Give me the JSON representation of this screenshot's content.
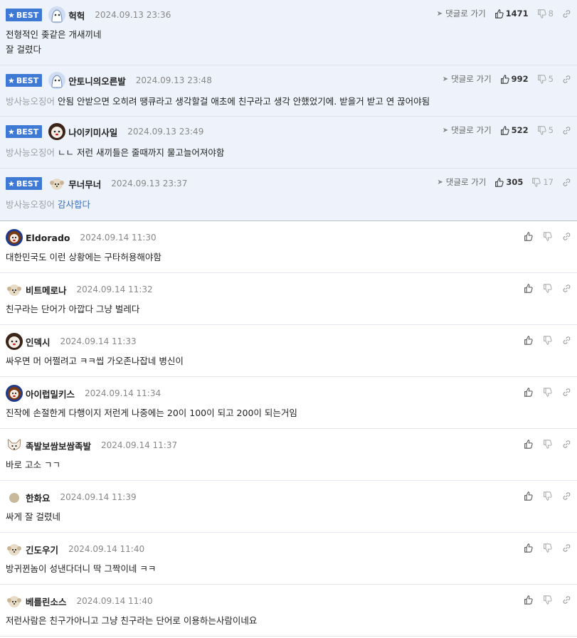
{
  "labels": {
    "best": "BEST",
    "goto_reply": "댓글로 가기"
  },
  "best_comments": [
    {
      "nick": "헉헉",
      "date": "2024.09.13 23:36",
      "up": "1471",
      "down": "8",
      "avatar": "ghost-avatar",
      "lines": [
        "전형적인 좆같은 개새끼네",
        "잘 걸렸다"
      ]
    },
    {
      "nick": "안토니의오른발",
      "date": "2024.09.13 23:48",
      "up": "992",
      "down": "5",
      "avatar": "ghost-avatar",
      "reply_to": "방사능오징어",
      "text": "안됨 안받으면 오히려 땡큐라고 생각할걸 애초에 친구라고 생각 안했었기에. 받을거 받고 연 끊어야됨"
    },
    {
      "nick": "나이키미사일",
      "date": "2024.09.13 23:49",
      "up": "522",
      "down": "5",
      "avatar": "dog-avatar",
      "reply_to": "방사능오징어",
      "text": "ㄴㄴ 저런 새끼들은 줄때까지 물고늘어져야함"
    },
    {
      "nick": "무너무너",
      "date": "2024.09.13 23:37",
      "up": "305",
      "down": "17",
      "avatar": "puppy-avatar",
      "reply_to": "방사능오징어",
      "text": "감사합다"
    }
  ],
  "comments": [
    {
      "nick": "Eldorado",
      "date": "2024.09.14 11:30",
      "avatar": "lion-avatar",
      "text": "대한민국도 이런 상황에는 구타허용해야함"
    },
    {
      "nick": "비트메로나",
      "date": "2024.09.14 11:32",
      "avatar": "puppy-avatar",
      "text": "친구라는 단어가 아깝다 그냥 벌레다"
    },
    {
      "nick": "인덱시",
      "date": "2024.09.14 11:33",
      "avatar": "dog-avatar",
      "text": "싸우면 머 어쩔려고 ㅋㅋ씹 가오존나잡네 병신이"
    },
    {
      "nick": "아이럽밀키스",
      "date": "2024.09.14 11:34",
      "avatar": "lion-avatar",
      "text": "진작에 손절한게 다행이지 저런게 나중에는 20이 100이 되고 200이 되는거임"
    },
    {
      "nick": "족발보쌈보쌈족발",
      "date": "2024.09.14 11:37",
      "avatar": "fox-avatar",
      "text": "바로 고소 ㄱㄱ"
    },
    {
      "nick": "한화요",
      "date": "2024.09.14 11:39",
      "avatar": "ball-avatar",
      "text": "싸게 잘 걸렸네"
    },
    {
      "nick": "긴도우기",
      "date": "2024.09.14 11:40",
      "avatar": "puppy-avatar",
      "text": "방귀뀐놈이 성낸다더니 딱 그짝이네 ㅋㅋ"
    },
    {
      "nick": "베를린소스",
      "date": "2024.09.14 11:40",
      "avatar": "puppy-avatar",
      "text": "저런사람은 친구가아니고 그냥 친구라는 단어로 이용하는사람이네요"
    }
  ],
  "colors": {
    "best_badge": "#3f79d6",
    "best_bg": "#eef3fb",
    "reply_blue": "#3a6fc0"
  }
}
